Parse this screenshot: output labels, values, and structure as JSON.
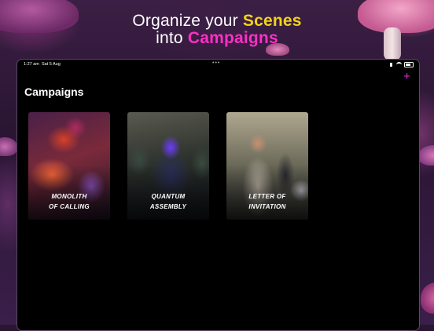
{
  "headline": {
    "line1_prefix": "Organize your ",
    "line1_highlight": "Scenes",
    "line2_prefix": "into ",
    "line2_highlight": "Campaigns"
  },
  "status_bar": {
    "time": "1:27 am",
    "date": "Sat 5 Aug",
    "dots": "•••"
  },
  "toolbar": {
    "add_label": "+"
  },
  "page": {
    "title": "Campaigns"
  },
  "campaigns": [
    {
      "title_line1": "MONOLITH",
      "title_line2": "OF CALLING"
    },
    {
      "title_line1": "",
      "title_line2": "QUANTUM ASSEMBLY"
    },
    {
      "title_line1": "LETTER OF",
      "title_line2": "INVITATION"
    }
  ],
  "colors": {
    "accent_yellow": "#f2d21b",
    "accent_pink": "#ff2fc6",
    "add_button": "#e02de0"
  }
}
